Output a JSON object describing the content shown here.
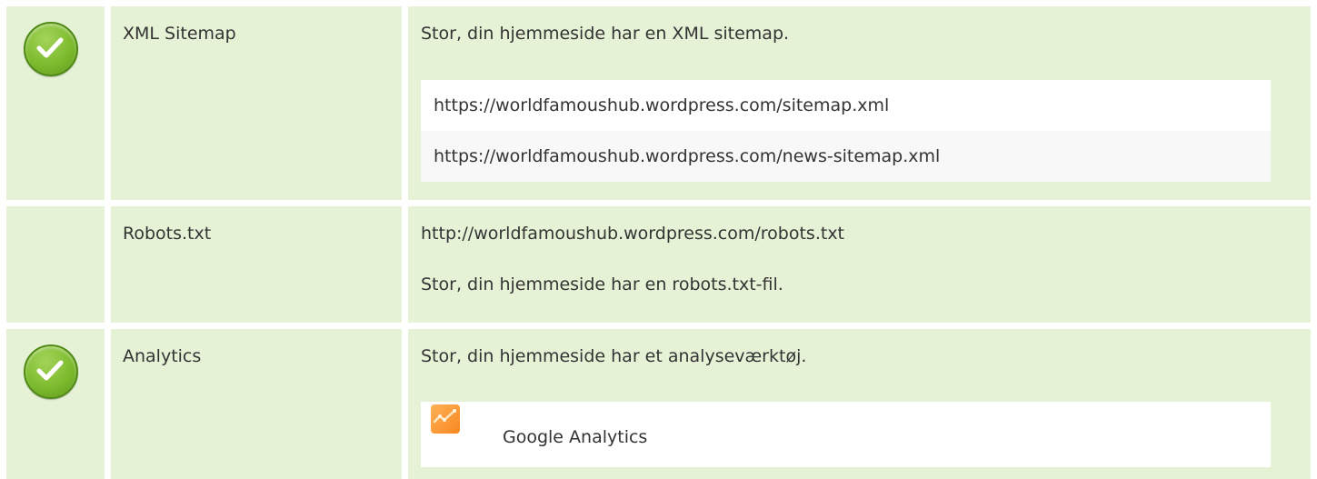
{
  "rows": [
    {
      "status": "pass",
      "label": "XML Sitemap",
      "message": "Stor, din hjemmeside har en XML sitemap.",
      "urls": [
        "https://worldfamoushub.wordpress.com/sitemap.xml",
        "https://worldfamoushub.wordpress.com/news-sitemap.xml"
      ]
    },
    {
      "status": "none",
      "label": "Robots.txt",
      "url": "http://worldfamoushub.wordpress.com/robots.txt",
      "message": "Stor, din hjemmeside har en robots.txt-fil."
    },
    {
      "status": "pass",
      "label": "Analytics",
      "message": "Stor, din hjemmeside har et analyseværktøj.",
      "tools": [
        {
          "icon": "google-analytics-icon",
          "name": "Google Analytics"
        }
      ]
    }
  ],
  "colors": {
    "row_background": "#e6f2d6",
    "check_green": "#7dbb2e",
    "analytics_orange": "#f7871f"
  }
}
